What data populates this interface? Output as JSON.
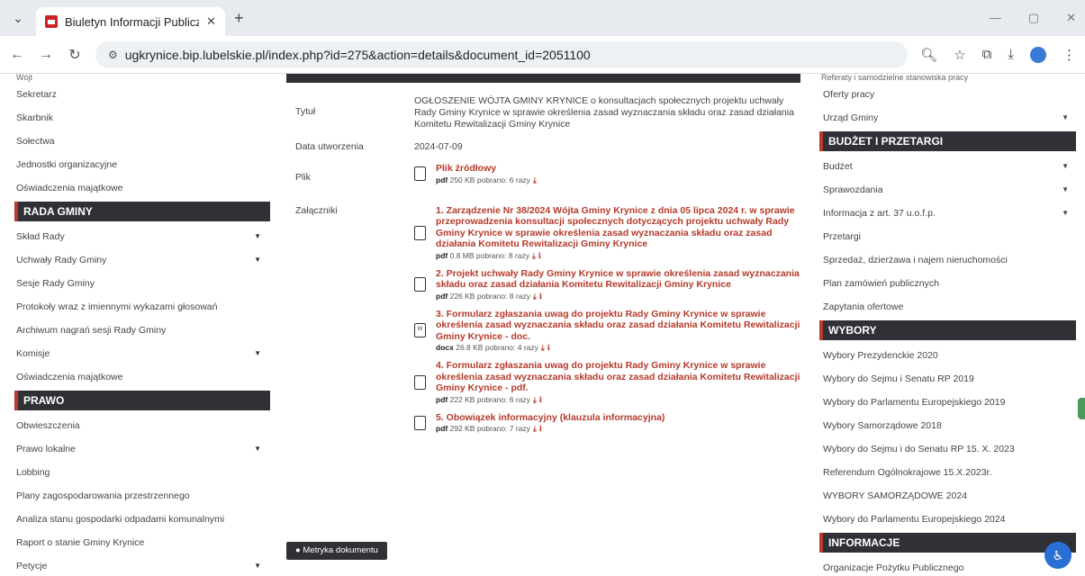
{
  "browser": {
    "tab_title": "Biuletyn Informacji Publicznej",
    "url": "ugkrynice.bip.lubelskie.pl/index.php?id=275&action=details&document_id=2051100"
  },
  "left": {
    "cut_top": "Wójt",
    "items_a": [
      "Sekretarz",
      "Skarbnik",
      "Sołectwa",
      "Jednostki organizacyjne",
      "Oświadczenia majątkowe"
    ],
    "sect_rada": "RADA GMINY",
    "items_rada": [
      "Skład Rady",
      "Uchwały Rady Gminy",
      "Sesje Rady Gminy",
      "Protokoły wraz z imiennymi wykazami głosowań",
      "Archiwum nagrań sesji Rady Gminy",
      "Komisje",
      "Oświadczenia majątkowe"
    ],
    "sect_prawo": "PRAWO",
    "items_prawo": [
      "Obwieszczenia",
      "Prawo lokalne",
      "Lobbing",
      "Plany zagospodarowania przestrzennego",
      "Analiza stanu gospodarki odpadami komunalnymi",
      "Raport o stanie Gminy Krynice",
      "Petycje"
    ]
  },
  "doc": {
    "label_title": "Tytuł",
    "title": "OGŁOSZENIE WÓJTA GMINY KRYNICE o konsultacjach społecznych projektu uchwały Rady Gminy Krynice w sprawie określenia zasad wyznaczania składu oraz zasad działania Komitetu Rewitalizacji Gminy Krynice",
    "label_date": "Data utworzenia",
    "date": "2024-07-09",
    "label_file": "Plik",
    "file": {
      "name": "Plik źródłowy",
      "type": "pdf",
      "size": "250 KB",
      "downloads": "pobrano: 6 razy"
    },
    "label_att": "Załączniki",
    "attachments": [
      {
        "name": "1. Zarządzenie Nr 38/2024 Wójta Gminy Krynice z dnia 05 lipca 2024 r. w sprawie przeprowadzenia konsultacji społecznych dotyczących projektu uchwały Rady Gminy Krynice w sprawie określenia zasad wyznaczania składu oraz zasad działania Komitetu Rewitalizacji Gminy Krynice",
        "type": "pdf",
        "size": "0.8 MB",
        "downloads": "pobrano: 8 razy"
      },
      {
        "name": "2. Projekt uchwały Rady Gminy Krynice w sprawie określenia zasad wyznaczania składu oraz zasad działania Komitetu Rewitalizacji Gminy Krynice",
        "type": "pdf",
        "size": "226 KB",
        "downloads": "pobrano: 8 razy"
      },
      {
        "name": "3. Formularz zgłaszania uwag do projektu Rady Gminy Krynice w sprawie określenia zasad wyznaczania składu oraz zasad działania Komitetu Rewitalizacji Gminy Krynice - doc.",
        "type": "docx",
        "size": "26.8 KB",
        "downloads": "pobrano: 4 razy"
      },
      {
        "name": "4. Formularz zgłaszania uwag do projektu Rady Gminy Krynice w sprawie określenia zasad wyznaczania składu oraz zasad działania Komitetu Rewitalizacji Gminy Krynice - pdf.",
        "type": "pdf",
        "size": "222 KB",
        "downloads": "pobrano: 6 razy"
      },
      {
        "name": "5. Obowiązek informacyjny (klauzula informacyjna)",
        "type": "pdf",
        "size": "292 KB",
        "downloads": "pobrano: 7 razy"
      }
    ],
    "metryka": "Metryka dokumentu"
  },
  "right": {
    "cut_top": "Referaty i samodzielne stanowiska pracy",
    "items_a": [
      "Oferty pracy",
      "Urząd Gminy"
    ],
    "sect_budzet": "BUDŻET I PRZETARGI",
    "items_budzet": [
      "Budżet",
      "Sprawozdania",
      "Informacja z art. 37 u.o.f.p.",
      "Przetargi",
      "Sprzedaż, dzierżawa i najem nieruchomości",
      "Plan zamówień publicznych",
      "Zapytania ofertowe"
    ],
    "sect_wybory": "WYBORY",
    "items_wybory": [
      "Wybory Prezydenckie 2020",
      "Wybory do Sejmu i Senatu RP 2019",
      "Wybory do Parlamentu Europejskiego 2019",
      "Wybory Samorządowe 2018",
      "Wybory do Sejmu i do Senatu RP 15. X. 2023",
      "Referendum Ogólnokrajowe 15.X.2023r.",
      "WYBORY SAMORZĄDOWE 2024",
      "Wybory do Parlamentu Europejskiego 2024"
    ],
    "sect_info": "INFORMACJE",
    "items_info": [
      "Organizacje Pożytku Publicznego"
    ]
  }
}
